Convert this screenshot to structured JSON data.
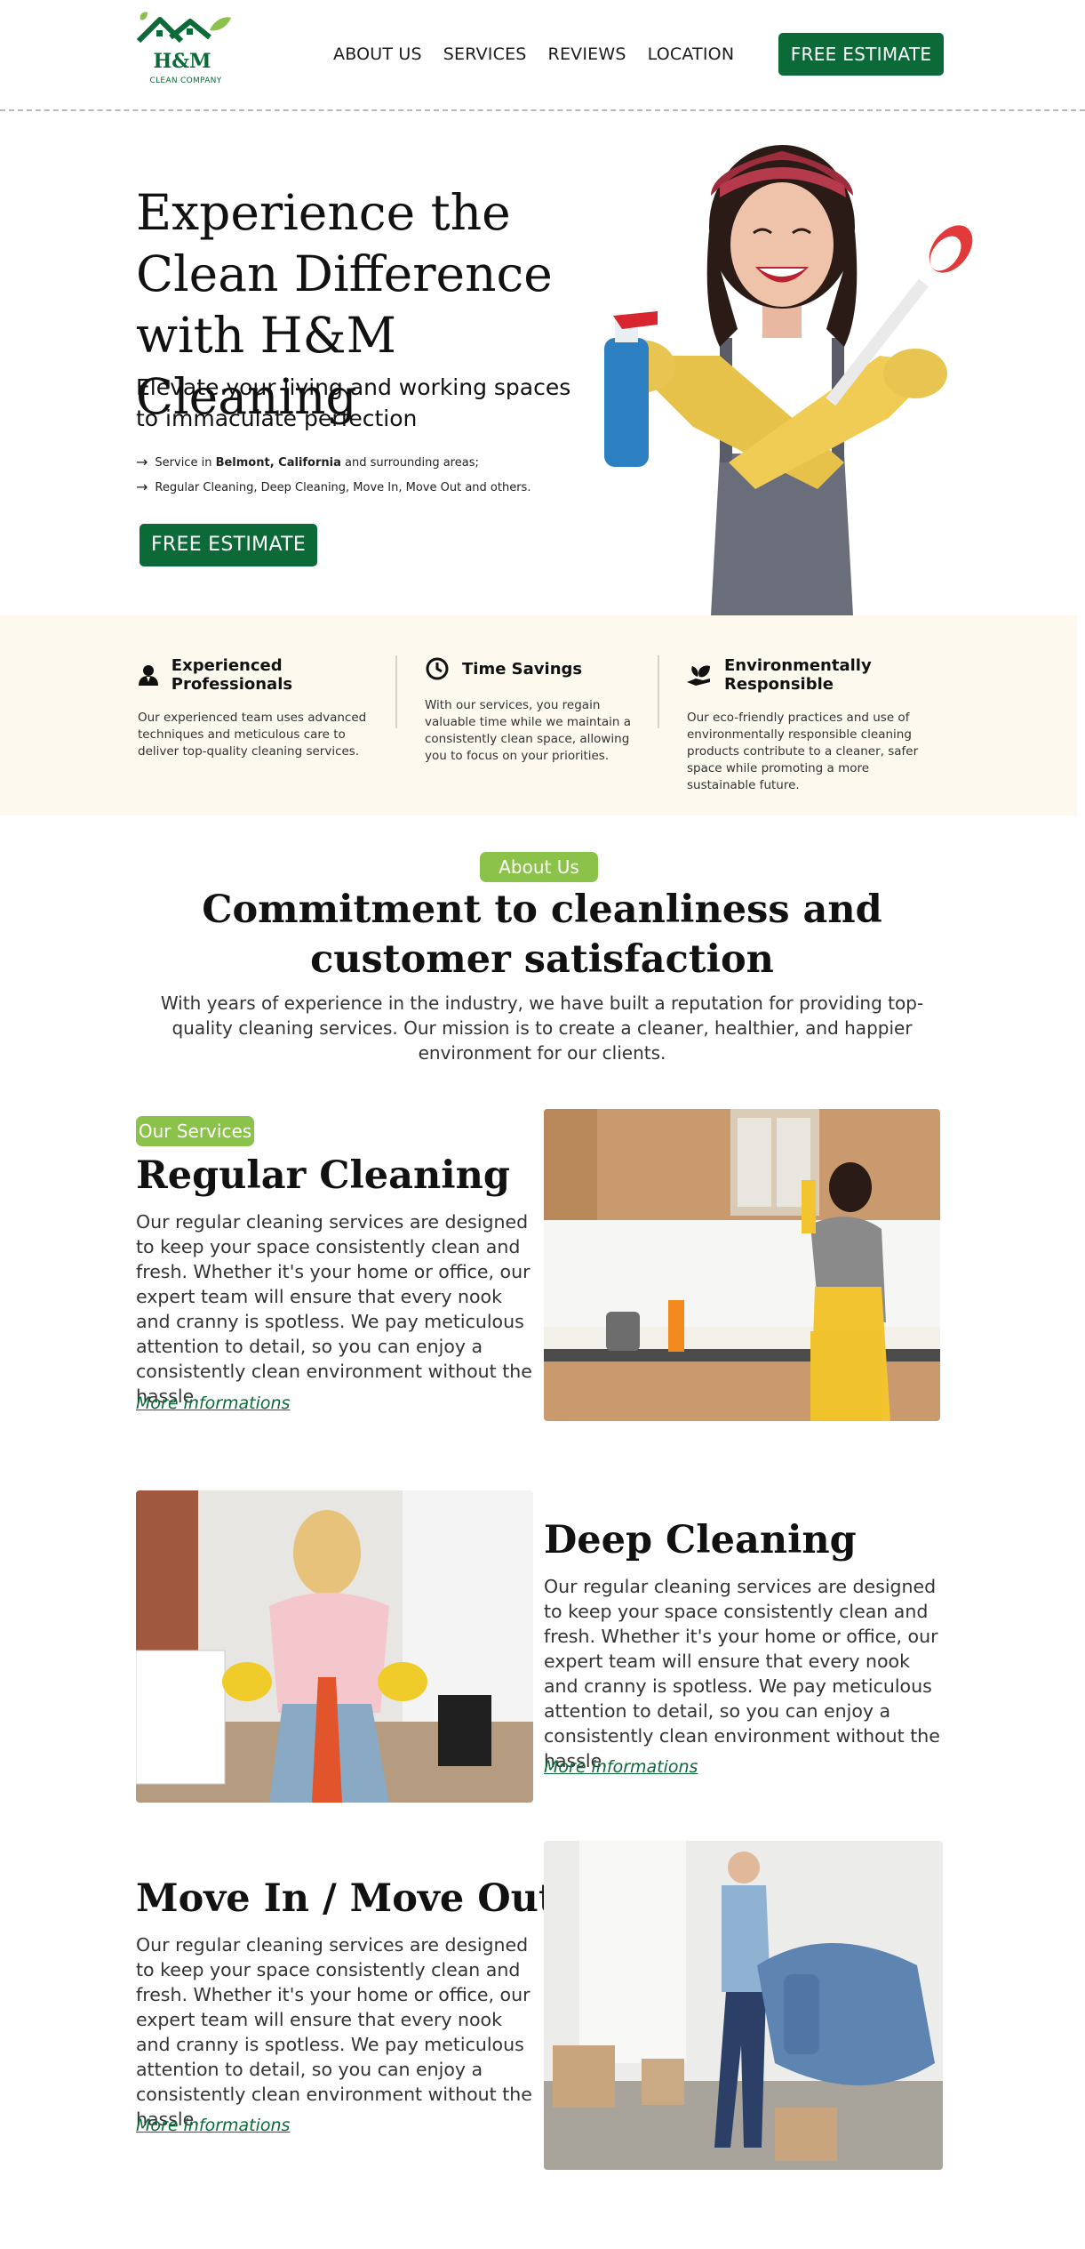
{
  "header": {
    "logo_text": "H&M",
    "logo_sub": "CLEAN COMPANY",
    "nav": [
      "ABOUT US",
      "SERVICES",
      "REVIEWS",
      "LOCATION"
    ],
    "cta": "FREE ESTIMATE"
  },
  "hero": {
    "title_lines": [
      "Experience the",
      "Clean Difference",
      "with H&M Cleaning"
    ],
    "subtitle": "Elevate your living and working spaces to immaculate perfection",
    "bullet1": {
      "pre": "Service in ",
      "bold": "Belmont, California",
      "post": " and surrounding areas;"
    },
    "bullet2": "Regular Cleaning, Deep Cleaning, Move In, Move Out and others.",
    "cta": "FREE ESTIMATE"
  },
  "features": [
    {
      "icon": "person-icon",
      "title": "Experienced Professionals",
      "text": "Our experienced team uses advanced techniques and meticulous care to deliver top-quality cleaning services."
    },
    {
      "icon": "clock-icon",
      "title": "Time Savings",
      "text": "With our services, you regain valuable time while we maintain a consistently clean space, allowing you to focus on your priorities."
    },
    {
      "icon": "leaf-hand-icon",
      "title": "Environmentally Responsible",
      "text": "Our eco-friendly practices and use of environmentally responsible cleaning products contribute to a cleaner, safer space while promoting a more sustainable future."
    }
  ],
  "about": {
    "pill": "About Us",
    "title_lines": [
      "Commitment to cleanliness and",
      "customer satisfaction"
    ],
    "text": "With years of experience in the industry, we have built a reputation for providing top-quality cleaning services. Our mission is to create a cleaner, healthier, and happier environment for our clients."
  },
  "services": {
    "pill": "Our Services",
    "items": [
      {
        "title": "Regular Cleaning",
        "text": "Our regular cleaning services are designed to keep your space consistently clean and fresh. Whether it's your home or office, our expert team will ensure that every nook and cranny is spotless. We pay meticulous attention to detail, so you can enjoy a consistently clean environment without the hassle.",
        "link": "More informations"
      },
      {
        "title": "Deep Cleaning",
        "text": "Our regular cleaning services are designed to keep your space consistently clean and fresh. Whether it's your home or office, our expert team will ensure that every nook and cranny is spotless. We pay meticulous attention to detail, so you can enjoy a consistently clean environment without the hassle.",
        "link": "More informations"
      },
      {
        "title": "Move In / Move Out",
        "text": "Our regular cleaning services are designed to keep your space consistently clean and fresh. Whether it's your home or office, our expert team will ensure that every nook and cranny is spotless. We pay meticulous attention to detail, so you can enjoy a consistently clean environment without the hassle.",
        "link": "More informations"
      }
    ]
  },
  "colors": {
    "brand_green": "#0b6a37",
    "accent_green": "#8bc34a",
    "feature_bg": "#fdf9ef"
  }
}
